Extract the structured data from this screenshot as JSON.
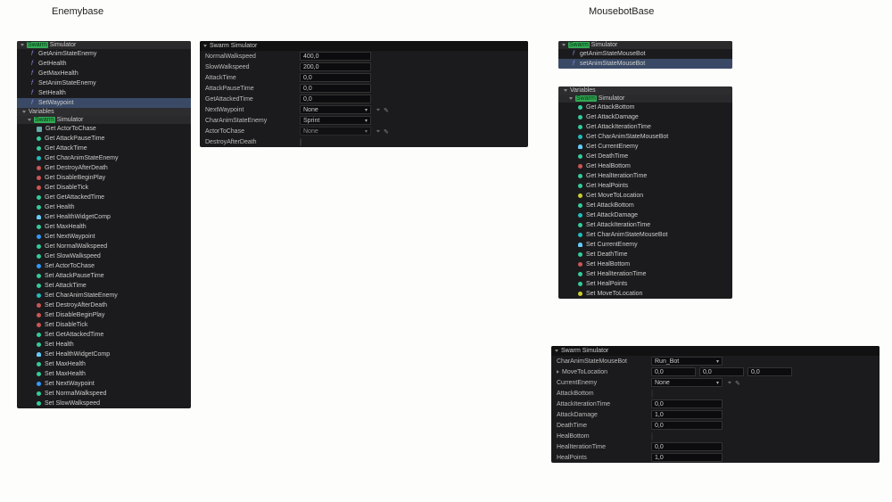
{
  "titles": {
    "left": "Enemybase",
    "right": "MousebotBase"
  },
  "leftTree": {
    "root": "Swarm Simulator",
    "root_hl": "Swarm",
    "root_rest": " Simulator",
    "funcs": [
      {
        "label": "GetAnimStateEnemy",
        "sel": false
      },
      {
        "label": "GetHealth",
        "sel": false
      },
      {
        "label": "GetMaxHealth",
        "sel": false
      },
      {
        "label": "SetAnimStateEnemy",
        "sel": false
      },
      {
        "label": "SetHealth",
        "sel": false
      },
      {
        "label": "SetWaypoint",
        "sel": true
      }
    ],
    "vars_header": "Variables",
    "vars_root_hl": "Swarm",
    "vars_root_rest": " Simulator",
    "vars": [
      {
        "c": "cube",
        "t": "Get ActorToChase"
      },
      {
        "c": "green",
        "t": "Get AttackPauseTime"
      },
      {
        "c": "green",
        "t": "Get AttackTime"
      },
      {
        "c": "teal",
        "t": "Get CharAnimStateEnemy"
      },
      {
        "c": "red",
        "t": "Get DestroyAfterDeath"
      },
      {
        "c": "red",
        "t": "Get DisableBeginPlay"
      },
      {
        "c": "red",
        "t": "Get DisableTick"
      },
      {
        "c": "green",
        "t": "Get GetAttackedTime"
      },
      {
        "c": "green",
        "t": "Get Health"
      },
      {
        "c": "person",
        "t": "Get HealthWidgetComp"
      },
      {
        "c": "green",
        "t": "Get MaxHealth"
      },
      {
        "c": "blue",
        "t": "Get NextWaypoint"
      },
      {
        "c": "green",
        "t": "Get NormalWalkspeed"
      },
      {
        "c": "green",
        "t": "Get SlowWalkspeed"
      },
      {
        "c": "blue",
        "t": "Set ActorToChase"
      },
      {
        "c": "green",
        "t": "Set AttackPauseTime"
      },
      {
        "c": "green",
        "t": "Set AttackTime"
      },
      {
        "c": "teal",
        "t": "Set CharAnimStateEnemy"
      },
      {
        "c": "red",
        "t": "Set DestroyAfterDeath"
      },
      {
        "c": "red",
        "t": "Set DisableBeginPlay"
      },
      {
        "c": "red",
        "t": "Set DisableTick"
      },
      {
        "c": "green",
        "t": "Set GetAttackedTime"
      },
      {
        "c": "green",
        "t": "Set Health"
      },
      {
        "c": "person",
        "t": "Set HealthWidgetComp"
      },
      {
        "c": "green",
        "t": "Set MaxHealth"
      },
      {
        "c": "green",
        "t": "Set MaxHealth"
      },
      {
        "c": "blue",
        "t": "Set NextWaypoint"
      },
      {
        "c": "green",
        "t": "Set NormalWalkspeed"
      },
      {
        "c": "green",
        "t": "Set SlowWalkspeed"
      }
    ]
  },
  "leftProps": {
    "header": "Swarm Simulator",
    "rows": [
      {
        "label": "NormalWalkspeed",
        "type": "num",
        "val": "400,0"
      },
      {
        "label": "SlowWalkspeed",
        "type": "num",
        "val": "200,0"
      },
      {
        "label": "AttackTime",
        "type": "num",
        "val": "0,0"
      },
      {
        "label": "AttackPauseTime",
        "type": "num",
        "val": "0,0"
      },
      {
        "label": "GetAttackedTime",
        "type": "num",
        "val": "0,0"
      },
      {
        "label": "NextWaypoint",
        "type": "dd",
        "val": "None",
        "extra": true
      },
      {
        "label": "CharAnimStateEnemy",
        "type": "dd",
        "val": "Sprint"
      },
      {
        "label": "ActorToChase",
        "type": "dd",
        "val": "None",
        "extra": true,
        "dim": true
      },
      {
        "label": "DestroyAfterDeath",
        "type": "chk"
      }
    ]
  },
  "rightTreeTop": {
    "root_hl": "Swarm",
    "root_rest": " Simulator",
    "funcs": [
      {
        "label": "getAnimStateMouseBot",
        "sel": false
      },
      {
        "label": "setAnimStateMouseBot",
        "sel": true
      }
    ]
  },
  "rightVars": {
    "vars_header": "Variables",
    "root_hl": "Swarm",
    "root_rest": " Simulator",
    "items": [
      {
        "c": "green",
        "t": "Get AttackBottom"
      },
      {
        "c": "green",
        "t": "Get AttackDamage"
      },
      {
        "c": "green",
        "t": "Get AttackIterationTime"
      },
      {
        "c": "teal",
        "t": "Get CharAnimStateMouseBot"
      },
      {
        "c": "person",
        "t": "Get CurrentEnemy"
      },
      {
        "c": "green",
        "t": "Get DeathTime"
      },
      {
        "c": "red",
        "t": "Get HealBottom"
      },
      {
        "c": "green",
        "t": "Get HealIterationTime"
      },
      {
        "c": "green",
        "t": "Get HealPoints"
      },
      {
        "c": "yellow",
        "t": "Get MoveToLocation"
      },
      {
        "c": "green",
        "t": "Set AttackBottom"
      },
      {
        "c": "teal",
        "t": "Set AttackDamage"
      },
      {
        "c": "green",
        "t": "Set AttackIterationTime"
      },
      {
        "c": "teal",
        "t": "Set CharAnimStateMouseBot"
      },
      {
        "c": "person",
        "t": "Set CurrentEnemy"
      },
      {
        "c": "green",
        "t": "Set DeathTime"
      },
      {
        "c": "red",
        "t": "Set HealBottom"
      },
      {
        "c": "green",
        "t": "Set HealIterationTime"
      },
      {
        "c": "green",
        "t": "Set HealPoints"
      },
      {
        "c": "yellow",
        "t": "Set MoveToLocation"
      }
    ]
  },
  "rightProps": {
    "header": "Swarm Simulator",
    "rows": [
      {
        "label": "CharAnimStateMouseBot",
        "type": "dd",
        "val": "Run_Bot"
      },
      {
        "label": "MoveToLocation",
        "type": "vec",
        "vals": [
          "0,0",
          "0,0",
          "0,0"
        ],
        "pre": true
      },
      {
        "label": "CurrentEnemy",
        "type": "dd",
        "val": "None",
        "extra": true
      },
      {
        "label": "AttackBottom",
        "type": "chkdim"
      },
      {
        "label": "AttackIterationTime",
        "type": "num",
        "val": "0,0"
      },
      {
        "label": "AttackDamage",
        "type": "num",
        "val": "1,0"
      },
      {
        "label": "DeathTime",
        "type": "num",
        "val": "0,0"
      },
      {
        "label": "HealBottom",
        "type": "chkdim"
      },
      {
        "label": "HealIterationTime",
        "type": "num",
        "val": "0,0"
      },
      {
        "label": "HealPoints",
        "type": "num",
        "val": "1,0"
      }
    ]
  }
}
